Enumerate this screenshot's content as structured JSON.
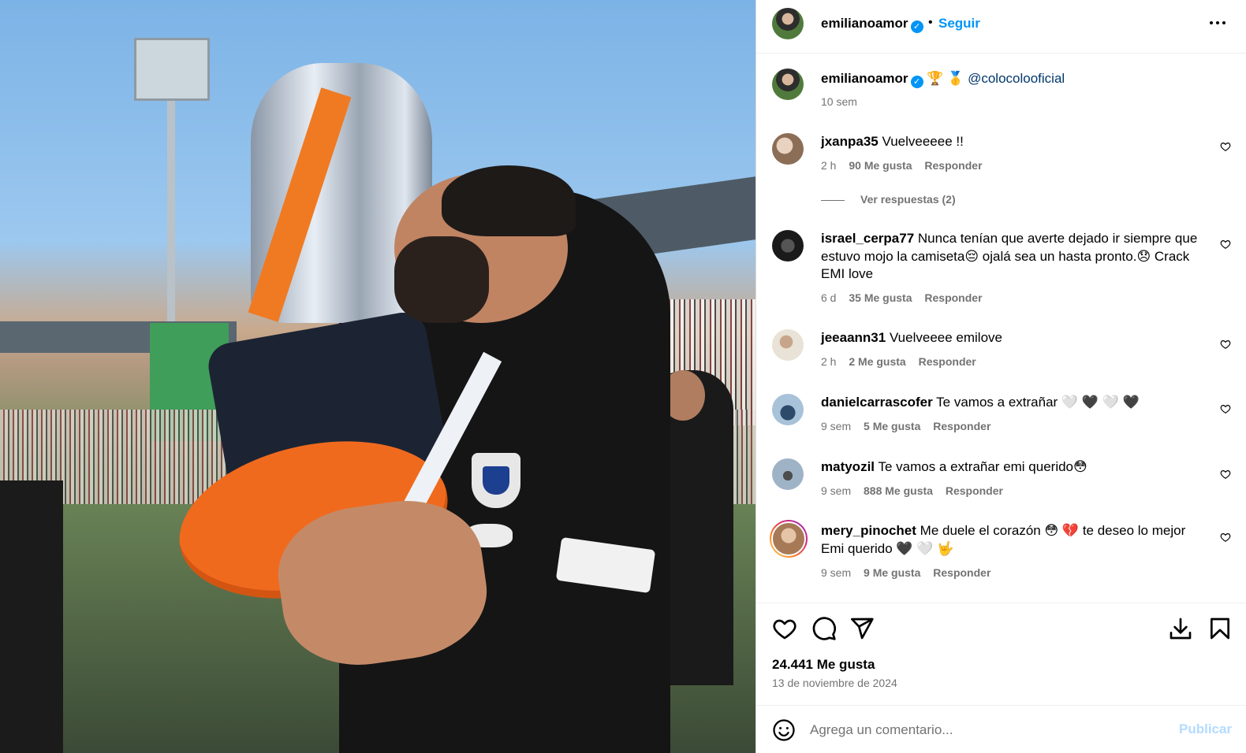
{
  "post": {
    "username": "emilianoamor",
    "verified_mark": "✓",
    "follow_label": "Seguir",
    "separator": "•",
    "more_icon": "more-options-icon",
    "caption_emojis": "🏆 🥇",
    "caption_mention": "@colocolooficial",
    "caption_time": "10 sem"
  },
  "comments": [
    {
      "user": "jxanpa35",
      "text": "Vuelveeeee !!",
      "time": "2 h",
      "likes": "90 Me gusta",
      "reply": "Responder"
    },
    {
      "user": "israel_cerpa77",
      "text": "Nunca tenían que averte dejado ir siempre que estuvo mojo la camiseta😔 ojalá sea un hasta pronto.😞 Crack EMI love",
      "time": "6 d",
      "likes": "35 Me gusta",
      "reply": "Responder"
    },
    {
      "user": "jeeaann31",
      "text": "Vuelveeee emilove",
      "time": "2 h",
      "likes": "2 Me gusta",
      "reply": "Responder"
    },
    {
      "user": "danielcarrascofer",
      "text": "Te vamos a extrañar 🤍 🖤 🤍 🖤",
      "time": "9 sem",
      "likes": "5 Me gusta",
      "reply": "Responder"
    },
    {
      "user": "matyozil",
      "text": "Te vamos a extrañar emi querido😳",
      "time": "9 sem",
      "likes": "888 Me gusta",
      "reply": "Responder"
    },
    {
      "user": "mery_pinochet",
      "text": "Me duele el corazón 😳 💔  te deseo lo mejor Emi querido 🖤 🤍 🤟",
      "time": "9 sem",
      "likes": "9 Me gusta",
      "reply": "Responder"
    }
  ],
  "view_replies": "Ver respuestas (2)",
  "actions": {
    "like_icon": "heart-icon",
    "comment_icon": "comment-icon",
    "share_icon": "share-icon",
    "download_icon": "download-icon",
    "save_icon": "bookmark-icon"
  },
  "stats": {
    "likes": "24.441 Me gusta",
    "date": "13 de noviembre de 2024"
  },
  "composer": {
    "placeholder": "Agrega un comentario...",
    "publish_label": "Publicar",
    "emoji_icon": "emoji-icon"
  },
  "colors": {
    "accent": "#0095f6",
    "mention": "#00376b",
    "muted": "#737373",
    "publish_disabled": "#b3dbff"
  }
}
